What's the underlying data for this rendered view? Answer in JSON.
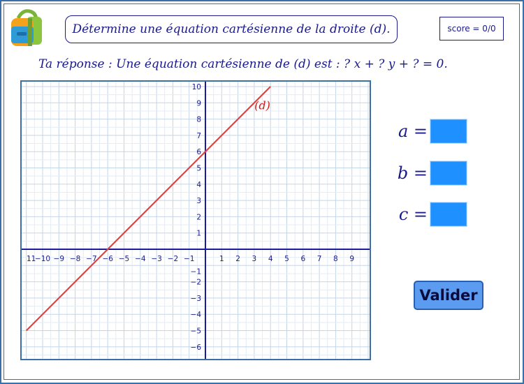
{
  "header": {
    "title": "Détermine une équation cartésienne de la droite (d).",
    "score": "score = 0/0"
  },
  "answer": {
    "text": "Ta réponse : Une équation cartésienne de (d) est : ? x + ? y + ? = 0."
  },
  "graph": {
    "x_ticks": [
      "11",
      "−10",
      "−9",
      "−8",
      "−7",
      "−6",
      "−5",
      "−4",
      "−3",
      "−2",
      "−1",
      "1",
      "2",
      "3",
      "4",
      "5",
      "6",
      "7",
      "8",
      "9"
    ],
    "y_ticks_pos": [
      "10",
      "9",
      "8",
      "7",
      "6",
      "5",
      "4",
      "3",
      "2",
      "1"
    ],
    "y_ticks_neg": [
      "−1",
      "−2",
      "−3",
      "−4",
      "−5",
      "−6"
    ],
    "line_label": "(d)",
    "line_color": "#e8413c",
    "line": {
      "x_intercept": -6,
      "y_intercept": 6,
      "from": [
        -11,
        -5
      ],
      "to": [
        4,
        10
      ]
    }
  },
  "inputs": {
    "a_label": "a =",
    "b_label": "b =",
    "c_label": "c ="
  },
  "buttons": {
    "validate": "Valider"
  },
  "icons": {
    "logo": "backpack-icon"
  }
}
